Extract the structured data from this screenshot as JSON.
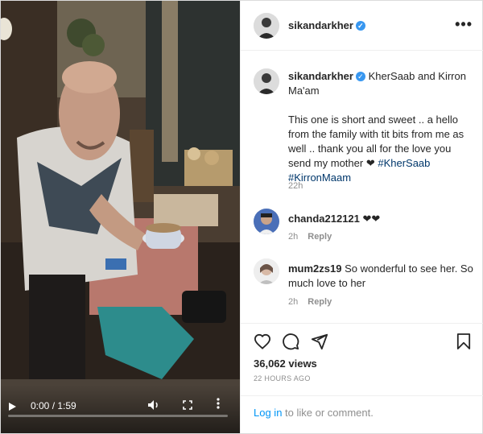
{
  "video": {
    "time": "0:00 / 1:59",
    "progress": 0
  },
  "header": {
    "username": "sikandarkher",
    "verified": true,
    "more_label": "•••"
  },
  "caption": {
    "username": "sikandarkher",
    "title_text": "KherSaab and Kirron Ma'am",
    "body_text": "This one is short and sweet .. a hello from the family with tit bits from me as well .. thank you all for the love you send my mother ❤",
    "hashtags": [
      "#KherSaab",
      "#KirronMaam"
    ],
    "time": "22h"
  },
  "comments": [
    {
      "username": "chanda212121",
      "text": "❤❤",
      "time": "2h",
      "reply": "Reply"
    },
    {
      "username": "mum2zs19",
      "text": "So wonderful to see her. So much love to her",
      "time": "2h",
      "reply": "Reply"
    }
  ],
  "stats": {
    "views": "36,062 views",
    "posted": "22 HOURS AGO"
  },
  "footer": {
    "login_link": "Log in",
    "login_text": "to like or comment."
  },
  "colors": {
    "verified": "#3897f0",
    "link": "#00376b",
    "login_link": "#0095f6",
    "muted": "#8e8e8e"
  }
}
